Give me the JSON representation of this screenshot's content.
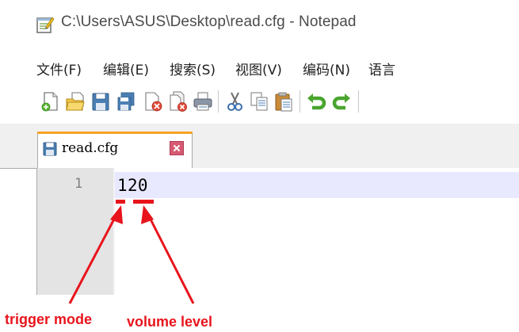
{
  "window": {
    "title": "C:\\Users\\ASUS\\Desktop\\read.cfg - Notepad"
  },
  "menu": {
    "items": [
      "文件(F)",
      "编辑(E)",
      "搜索(S)",
      "视图(V)",
      "编码(N)",
      "语言"
    ]
  },
  "toolbar": {
    "buttons": [
      "new-file-icon",
      "open-file-icon",
      "save-icon",
      "save-all-icon",
      "close-icon",
      "close-all-icon",
      "print-icon",
      "cut-icon",
      "copy-icon",
      "paste-icon",
      "undo-icon",
      "redo-icon"
    ]
  },
  "tab": {
    "label": "read.cfg"
  },
  "editor": {
    "line_number": "1",
    "line_text": "120"
  },
  "annotations": {
    "trigger_label": "trigger mode",
    "volume_label": "volume level",
    "color": "#e8141c"
  }
}
